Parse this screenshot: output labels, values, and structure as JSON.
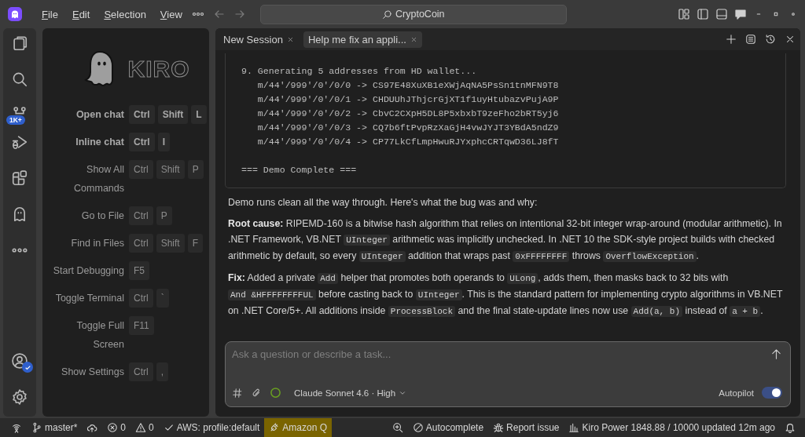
{
  "title_bar": {
    "menu": [
      "File",
      "Edit",
      "Selection",
      "View"
    ],
    "search": "CryptoCoin"
  },
  "activity_bar": {
    "source_control_badge": "1K+"
  },
  "welcome": {
    "logo_text": "KIRO",
    "shortcuts": [
      {
        "label": "Open chat",
        "keys": [
          "Ctrl",
          "Shift",
          "L"
        ],
        "highlighted": true
      },
      {
        "label": "Inline chat",
        "keys": [
          "Ctrl",
          "I"
        ],
        "highlighted": true
      },
      {
        "label": "Show All Commands",
        "keys": [
          "Ctrl",
          "Shift",
          "P"
        ],
        "highlighted": false
      },
      {
        "label": "Go to File",
        "keys": [
          "Ctrl",
          "P"
        ],
        "highlighted": false
      },
      {
        "label": "Find in Files",
        "keys": [
          "Ctrl",
          "Shift",
          "F"
        ],
        "highlighted": false
      },
      {
        "label": "Start Debugging",
        "keys": [
          "F5"
        ],
        "highlighted": false
      },
      {
        "label": "Toggle Terminal",
        "keys": [
          "Ctrl",
          "`"
        ],
        "highlighted": false
      },
      {
        "label": "Toggle Full Screen",
        "keys": [
          "F11"
        ],
        "highlighted": false
      },
      {
        "label": "Show Settings",
        "keys": [
          "Ctrl",
          ","
        ],
        "highlighted": false
      }
    ]
  },
  "chat": {
    "tabs": [
      {
        "label": "New Session",
        "selected": false
      },
      {
        "label": "Help me fix an appli...",
        "selected": true
      }
    ],
    "code_block": [
      {
        "lines": [
          "9. Generating 5 addresses from HD wallet...",
          "   m/44'/999'/0'/0/0 -> CS97E48XuXB1eXWjAqNA5PsSn1tnMFN9T8",
          "   m/44'/999'/0'/0/1 -> CHDUUhJThjcrGjXT1f1uyHtubazvPujA9P",
          "   m/44'/999'/0'/0/2 -> CbvC2CXpH5DL8P5xbxbT9zeFho2bRT5yj6",
          "   m/44'/999'/0'/0/3 -> CQ7b6ftPvpRzXaGjH4vwJYJT3YBdA5ndZ9",
          "   m/44'/999'/0'/0/4 -> CP77LkCfLmpHwuRJYxphcCRTqwD36LJ8fT"
        ]
      },
      {
        "lines": [
          "=== Demo Complete ==="
        ]
      }
    ],
    "paragraphs": [
      [
        {
          "kind": "text",
          "text": "Demo runs clean all the way through. Here's what the bug was and why:"
        }
      ],
      [
        {
          "kind": "text",
          "text": "**Root cause:** RIPEMD-160 is a bitwise hash algorithm that relies on intentional 32-bit integer wrap-around (modular arithmetic). In .NET Framework, VB.NET "
        },
        {
          "kind": "code",
          "text": "UInteger"
        },
        {
          "kind": "text",
          "text": " arithmetic was implicitly unchecked. In .NET 10 the SDK-style project builds with checked arithmetic by default, so every "
        },
        {
          "kind": "code",
          "text": "UInteger"
        },
        {
          "kind": "text",
          "text": " addition that wraps past "
        },
        {
          "kind": "code",
          "text": "0xFFFFFFFF"
        },
        {
          "kind": "text",
          "text": " throws "
        },
        {
          "kind": "code",
          "text": "OverflowException"
        },
        {
          "kind": "text",
          "text": "."
        }
      ],
      [
        {
          "kind": "text",
          "text": "**Fix:** Added a private "
        },
        {
          "kind": "code",
          "text": "Add"
        },
        {
          "kind": "text",
          "text": " helper that promotes both operands to "
        },
        {
          "kind": "code",
          "text": "ULong"
        },
        {
          "kind": "text",
          "text": ", adds them, then masks back to 32 bits with "
        },
        {
          "kind": "code",
          "text": "And &HFFFFFFFFUL"
        },
        {
          "kind": "text",
          "text": " before casting back to "
        },
        {
          "kind": "code",
          "text": "UInteger"
        },
        {
          "kind": "text",
          "text": ". This is the standard pattern for implementing crypto algorithms in VB.NET on .NET Core/5+. All additions inside "
        },
        {
          "kind": "code",
          "text": "ProcessBlock"
        },
        {
          "kind": "text",
          "text": " and the final state-update lines now use "
        },
        {
          "kind": "code",
          "text": "Add(a, b)"
        },
        {
          "kind": "text",
          "text": " instead of "
        },
        {
          "kind": "code",
          "text": "a + b"
        },
        {
          "kind": "text",
          "text": "."
        }
      ]
    ],
    "input": {
      "placeholder": "Ask a question or describe a task...",
      "model": "Claude Sonnet 4.6 · High",
      "autopilot_label": "Autopilot",
      "autopilot_on": true
    }
  },
  "status_bar": [
    {
      "kind": "remote",
      "highlighted": false
    },
    {
      "kind": "branch",
      "text": "master*",
      "highlighted": false
    },
    {
      "kind": "sync",
      "highlighted": false
    },
    {
      "kind": "errors",
      "text": "0",
      "highlighted": false
    },
    {
      "kind": "warnings",
      "text": "0",
      "highlighted": false
    },
    {
      "kind": "check",
      "text": "AWS: profile:default",
      "highlighted": false
    },
    {
      "kind": "plug",
      "text": "Amazon Q",
      "highlighted": true
    },
    {
      "kind": "zoom",
      "highlighted": false
    },
    {
      "kind": "blocked",
      "text": "Autocomplete",
      "highlighted": false
    },
    {
      "kind": "bug",
      "text": "Report issue",
      "highlighted": false
    },
    {
      "kind": "chart",
      "text": "Kiro Power 1848.88 / 10000 updated 12m ago",
      "highlighted": false
    },
    {
      "kind": "bell",
      "highlighted": false
    }
  ]
}
